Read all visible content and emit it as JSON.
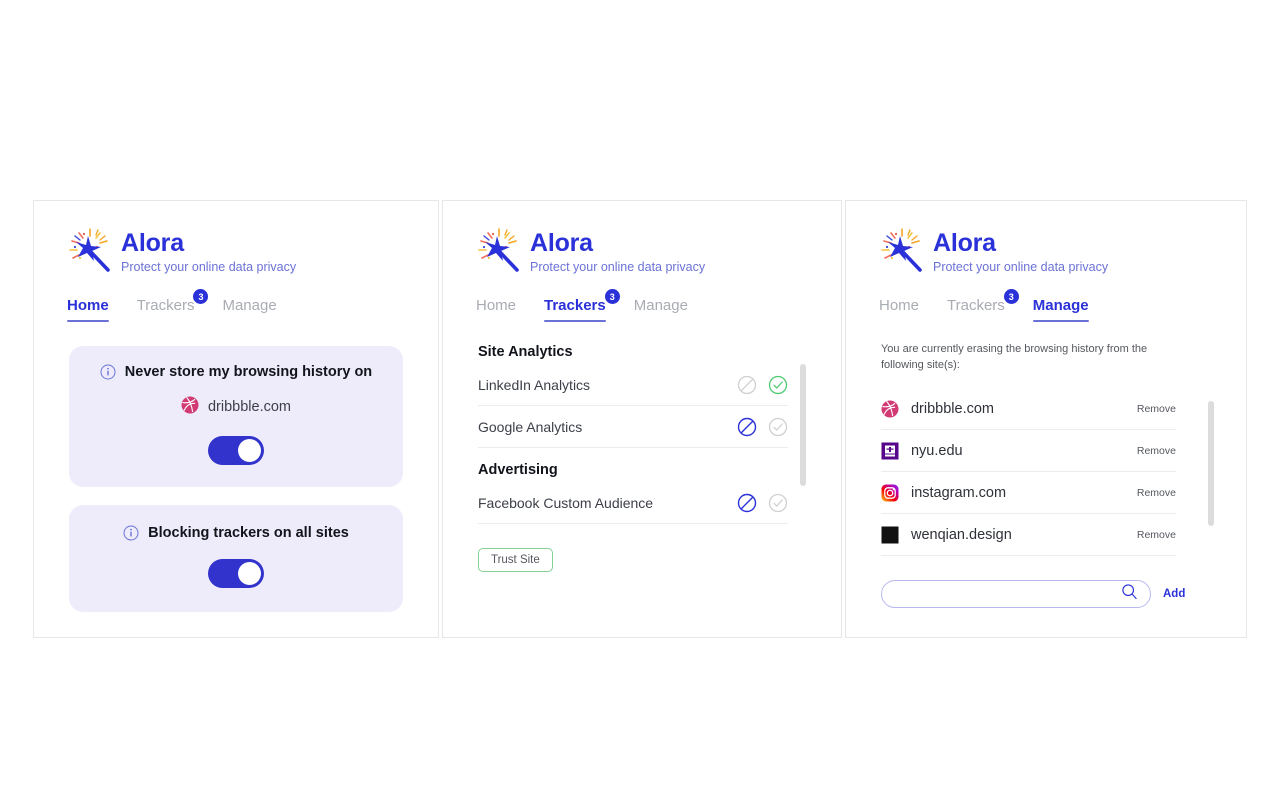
{
  "brand": {
    "title": "Alora",
    "subtitle": "Protect your online data privacy",
    "logo_icon": "magic-wand-sparkle-icon",
    "title_color": "#2b31d8",
    "subtitle_color": "#6b72d6"
  },
  "tabs": {
    "home": "Home",
    "trackers": "Trackers",
    "manage": "Manage",
    "trackers_badge": "3"
  },
  "colors": {
    "accent": "#2b31d8",
    "toggle_on": "#3232cd",
    "card_bg": "#eeecfb",
    "green": "#4ecb71",
    "trust_border": "#86d096",
    "muted": "#a9acb3"
  },
  "panel_home": {
    "active_tab": "Home",
    "cards": [
      {
        "info_icon": "info-circle-icon",
        "title": "Never store my browsing history on",
        "site": "dribbble.com",
        "site_icon": "dribbble-icon",
        "toggle_state": "on"
      },
      {
        "info_icon": "info-circle-icon",
        "title": "Blocking trackers on all sites",
        "site": null,
        "toggle_state": "on"
      }
    ]
  },
  "panel_trackers": {
    "active_tab": "Trackers",
    "groups": [
      {
        "title": "Site Analytics",
        "items": [
          {
            "name": "LinkedIn Analytics",
            "block_state": "inactive",
            "allow_state": "active"
          },
          {
            "name": "Google Analytics",
            "block_state": "active",
            "allow_state": "inactive"
          }
        ]
      },
      {
        "title": "Advertising",
        "items": [
          {
            "name": "Facebook Custom Audience",
            "block_state": "active",
            "allow_state": "inactive"
          }
        ]
      }
    ],
    "trust_button": "Trust Site"
  },
  "panel_manage": {
    "active_tab": "Manage",
    "note": "You are currently erasing the browsing history from the following site(s):",
    "sites": [
      {
        "name": "dribbble.com",
        "icon": "dribbble-icon",
        "remove_label": "Remove"
      },
      {
        "name": "nyu.edu",
        "icon": "nyu-icon",
        "remove_label": "Remove"
      },
      {
        "name": "instagram.com",
        "icon": "instagram-icon",
        "remove_label": "Remove"
      },
      {
        "name": "wenqian.design",
        "icon": "black-square-icon",
        "remove_label": "Remove"
      }
    ],
    "search": {
      "value": "",
      "placeholder": "",
      "icon": "search-icon"
    },
    "add_label": "Add"
  }
}
